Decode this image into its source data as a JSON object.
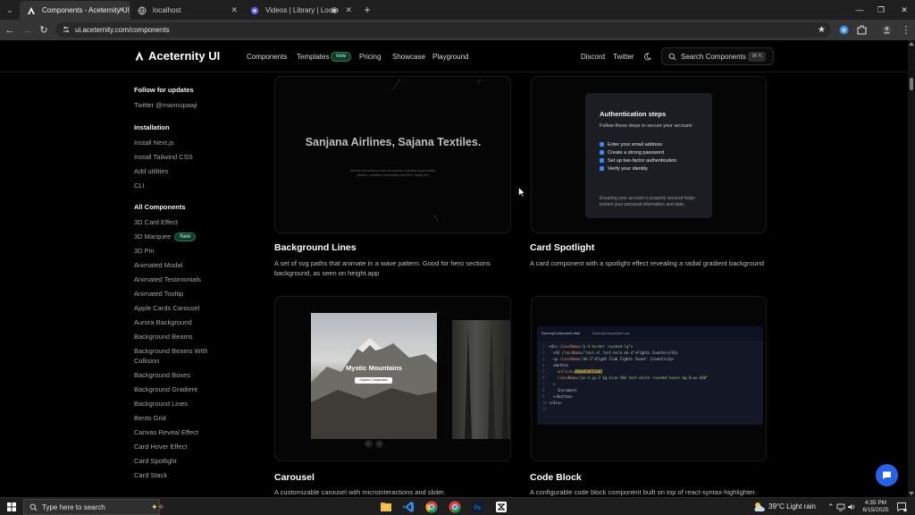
{
  "browser": {
    "tabs": [
      {
        "title": "Components - Aceternity UI",
        "active": true
      },
      {
        "title": "localhost",
        "active": false
      },
      {
        "title": "Videos | Library | Loom",
        "active": false
      }
    ],
    "url": "ui.aceternity.com/components"
  },
  "site": {
    "logo": "Aceternity UI",
    "nav": [
      "Components",
      "Templates",
      "Pricing",
      "Showcase",
      "Playground"
    ],
    "new_badge": "new",
    "right_links": [
      "Discord",
      "Twitter"
    ],
    "search_placeholder": "Search Components",
    "search_shortcut": "⌘ K"
  },
  "sidebar": {
    "follow_heading": "Follow for updates",
    "follow_link": "Twitter @mannupaaji",
    "install_heading": "Installation",
    "install_links": [
      "Install Next.js",
      "Install Tailwind CSS",
      "Add utilities",
      "CLI"
    ],
    "components_heading": "All Components",
    "new_badge": "New",
    "component_links": [
      "3D Card Effect",
      "3D Marquee",
      "3D Pin",
      "Animated Modal",
      "Animated Testimonials",
      "Animated Tooltip",
      "Apple Cards Carousel",
      "Aurora Background",
      "Background Beams",
      "Background Beams With",
      "Collision",
      "Background Boxes",
      "Background Gradient",
      "Background Lines",
      "Bento Grid",
      "Canvas Reveal Effect",
      "Card Hover Effect",
      "Card Spotlight",
      "Card Stack"
    ]
  },
  "cards": [
    {
      "title": "Background Lines",
      "description": "A set of svg paths that animate in a wave pattern. Good for hero sections background, as seen on height.app",
      "preview_heading": "Sanjana Airlines, Sajana Textiles.",
      "preview_sub": "Get the best advices from our experts, including expert artists, painters, marathon enthusiasts and RDX, totally free."
    },
    {
      "title": "Card Spotlight",
      "description": "A card component with a spotlight effect revealing a radial gradient background",
      "preview_title": "Authentication steps",
      "preview_lead": "Follow these steps to secure your account:",
      "preview_steps": [
        "Enter your email address",
        "Create a strong password",
        "Set up two-factor authentication",
        "Verify your identity"
      ],
      "preview_foot": "Ensuring your account is properly secured helps protect your personal information and data."
    },
    {
      "title": "Carousel",
      "description": "A customizable carousel with microinteractions and slider.",
      "preview_caption": "Mystic Mountains",
      "preview_button": "Explore Component",
      "prev_icon": "←",
      "next_icon": "→"
    },
    {
      "title": "Code Block",
      "description": "A configurable code block component built on top of react-syntax-highlighter.",
      "preview_tabs": [
        "DummyComponent.html",
        "DummyComponent.css"
      ]
    }
  ],
  "taskbar": {
    "search_placeholder": "Type here to search",
    "weather": "39°C  Light rain",
    "time": "4:35 PM",
    "date": "6/15/2025"
  },
  "colors": {
    "accent_blue": "#3b82f6",
    "new_badge_green": "#1f7a55",
    "page_bg": "#000000"
  }
}
